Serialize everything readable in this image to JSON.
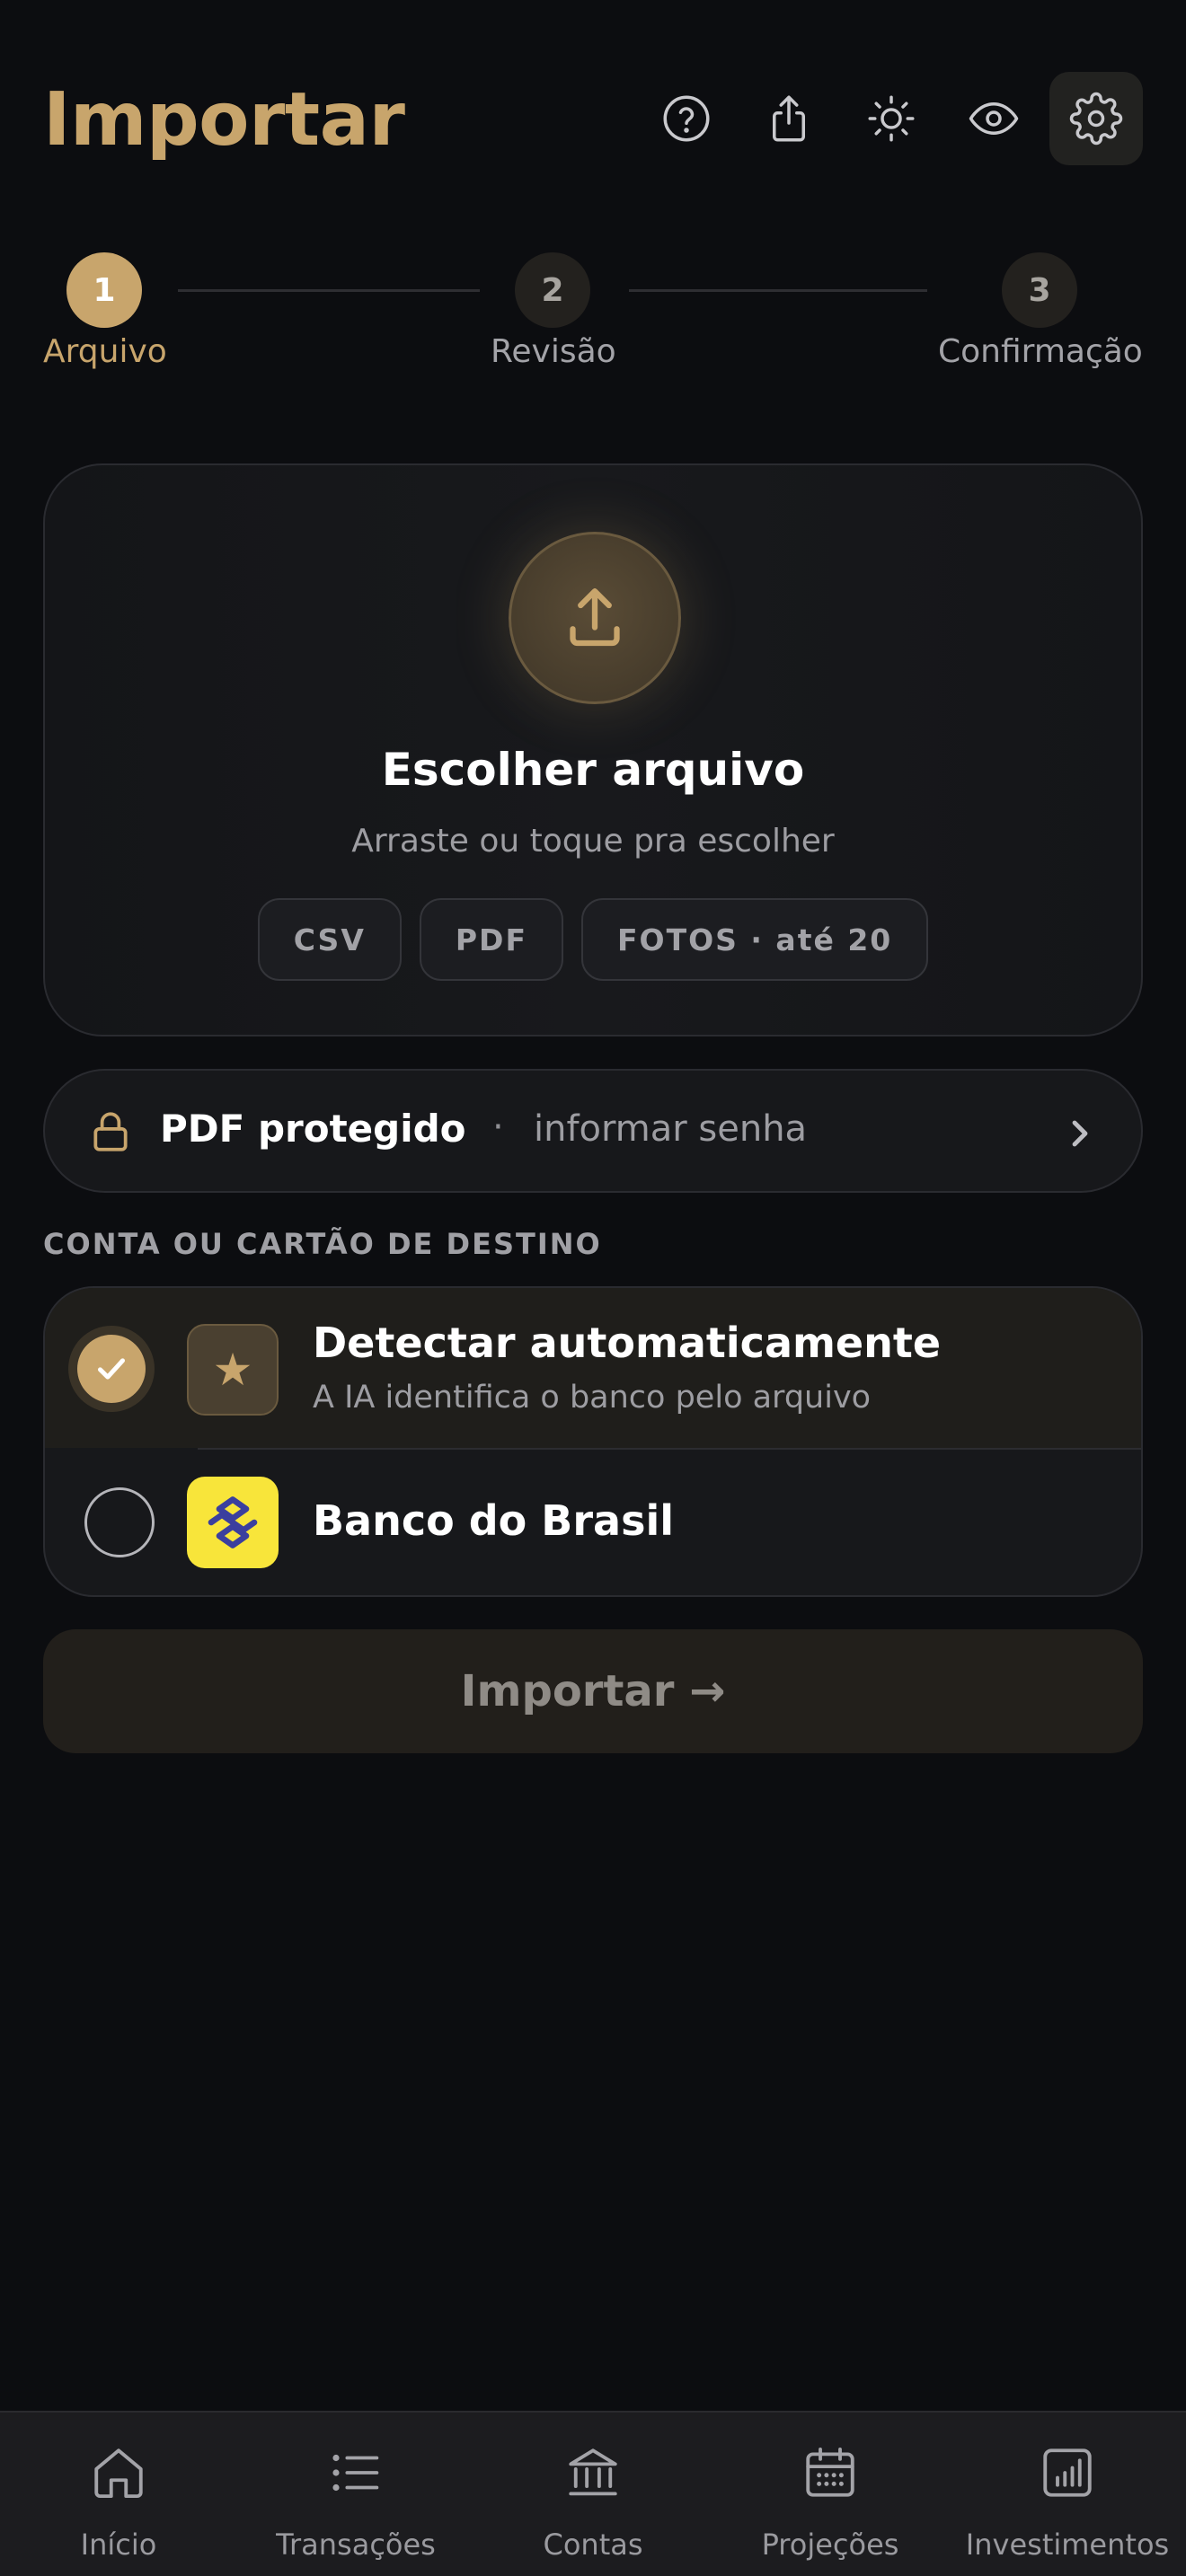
{
  "header": {
    "title": "Importar",
    "icons": [
      "help-icon",
      "share-icon",
      "sun-icon",
      "eye-icon",
      "gear-icon"
    ]
  },
  "stepper": {
    "steps": [
      {
        "number": "1",
        "label": "Arquivo",
        "active": true
      },
      {
        "number": "2",
        "label": "Revisão",
        "active": false
      },
      {
        "number": "3",
        "label": "Confirmação",
        "active": false
      }
    ]
  },
  "upload": {
    "icon": "upload-icon",
    "title": "Escolher arquivo",
    "subtitle": "Arraste ou toque pra escolher",
    "formats": [
      "CSV",
      "PDF",
      "FOTOS · até 20"
    ]
  },
  "pdf_protected": {
    "icon": "lock-icon",
    "title": "PDF protegido",
    "separator": "·",
    "hint": "informar senha"
  },
  "destination": {
    "section_label": "CONTA OU CARTÃO DE DESTINO",
    "options": [
      {
        "title": "Detectar automaticamente",
        "subtitle": "A IA identifica o banco pelo arquivo",
        "selected": true,
        "badge": "★"
      },
      {
        "title": "Banco do Brasil",
        "subtitle": "",
        "selected": false
      }
    ]
  },
  "import_button": {
    "label": "Importar →"
  },
  "tabbar": {
    "items": [
      {
        "label": "Início",
        "icon": "home-icon"
      },
      {
        "label": "Transações",
        "icon": "list-icon"
      },
      {
        "label": "Contas",
        "icon": "bank-icon"
      },
      {
        "label": "Projeções",
        "icon": "calendar-icon"
      },
      {
        "label": "Investimentos",
        "icon": "chart-icon"
      }
    ]
  },
  "colors": {
    "accent": "#c8a56c",
    "background": "#0c0d10",
    "card": "#17181b",
    "bb_yellow": "#f8e53a",
    "bb_blue": "#3b3f9e"
  }
}
